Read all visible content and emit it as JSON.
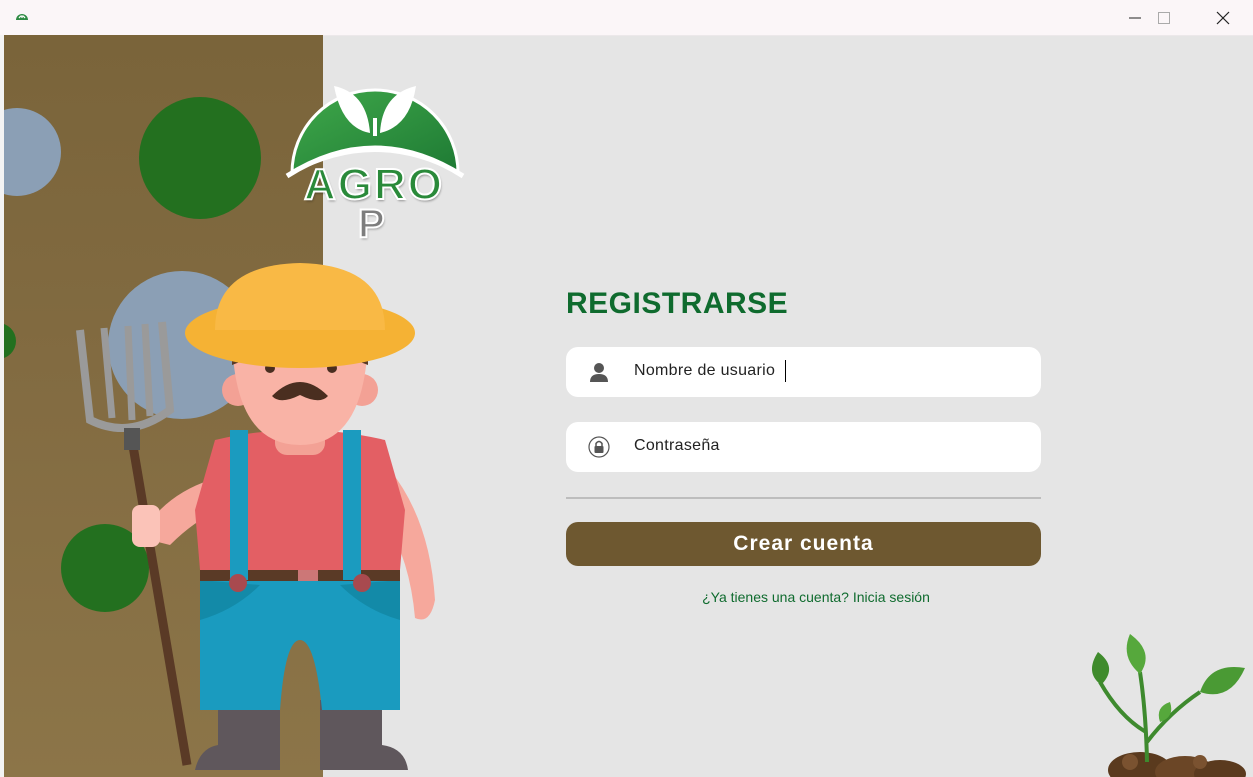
{
  "window": {
    "controls": [
      "minimize",
      "maximize",
      "close"
    ]
  },
  "logo": {
    "text_line1": "AGRO",
    "text_line2": "P"
  },
  "form": {
    "title": "REGISTRARSE",
    "username_value": "Nombre de usuario",
    "password_value": "Contraseña",
    "submit_label": "Crear cuenta",
    "login_link": "¿Ya tienes una cuenta? Inicia sesión"
  },
  "colors": {
    "brand_green": "#0f6b2e",
    "button_brown": "#6e5830",
    "panel_brown": "#836c42",
    "background": "#e5e5e5"
  },
  "icons": [
    "app-logo-icon",
    "minimize-icon",
    "maximize-icon",
    "close-icon",
    "user-icon",
    "lock-icon",
    "sprout-icon"
  ]
}
